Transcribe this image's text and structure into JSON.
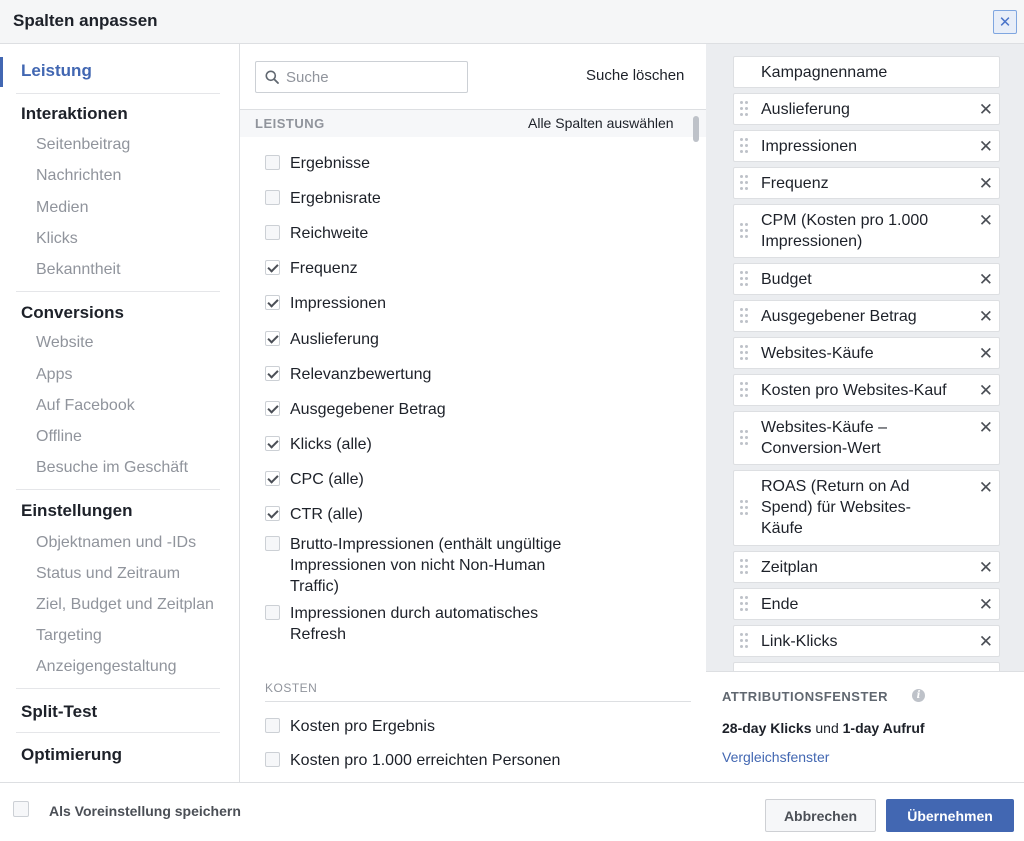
{
  "dialog": {
    "title": "Spalten anpassen",
    "close_icon": "close-icon",
    "close_glyph": "✕"
  },
  "sidebar": {
    "sections": [
      {
        "label": "Leistung",
        "active": true,
        "items": []
      },
      {
        "label": "Interaktionen",
        "items": [
          "Seitenbeitrag",
          "Nachrichten",
          "Medien",
          "Klicks",
          "Bekanntheit"
        ]
      },
      {
        "label": "Conversions",
        "items": [
          "Website",
          "Apps",
          "Auf Facebook",
          "Offline",
          "Besuche im Geschäft"
        ]
      },
      {
        "label": "Einstellungen",
        "items": [
          "Objektnamen und -IDs",
          "Status und Zeitraum",
          "Ziel, Budget und Zeitplan",
          "Targeting",
          "Anzeigengestaltung"
        ]
      },
      {
        "label": "Split-Test",
        "items": []
      },
      {
        "label": "Optimierung",
        "items": []
      }
    ]
  },
  "search": {
    "placeholder": "Suche",
    "value": "",
    "clear_label": "Suche löschen"
  },
  "metrics": {
    "section_label": "LEISTUNG",
    "select_all_label": "Alle Spalten auswählen",
    "options": [
      {
        "label": "Ergebnisse",
        "checked": false
      },
      {
        "label": "Ergebnisrate",
        "checked": false
      },
      {
        "label": "Reichweite",
        "checked": false
      },
      {
        "label": "Frequenz",
        "checked": true
      },
      {
        "label": "Impressionen",
        "checked": true
      },
      {
        "label": "Auslieferung",
        "checked": true
      },
      {
        "label": "Relevanzbewertung",
        "checked": true
      },
      {
        "label": "Ausgegebener Betrag",
        "checked": true
      },
      {
        "label": "Klicks (alle)",
        "checked": true
      },
      {
        "label": "CPC (alle)",
        "checked": true
      },
      {
        "label": "CTR (alle)",
        "checked": true
      },
      {
        "label": "Brutto-Impressionen (enthält ungültige Impressionen von nicht Non-Human Traffic)",
        "checked": false
      },
      {
        "label": "Impressionen durch automatisches Refresh",
        "checked": false
      }
    ],
    "cost_section_label": "KOSTEN",
    "cost_options": [
      {
        "label": "Kosten pro Ergebnis",
        "checked": false
      },
      {
        "label": "Kosten pro 1.000 erreichten Personen",
        "checked": false
      }
    ]
  },
  "selected_columns": {
    "items": [
      {
        "label": "Kampagnenname",
        "fixed": true
      },
      {
        "label": "Auslieferung"
      },
      {
        "label": "Impressionen"
      },
      {
        "label": "Frequenz"
      },
      {
        "label": "CPM (Kosten pro 1.000 Impressionen)"
      },
      {
        "label": "Budget"
      },
      {
        "label": "Ausgegebener Betrag"
      },
      {
        "label": "Websites-Käufe"
      },
      {
        "label": "Kosten pro Websites-Kauf"
      },
      {
        "label": "Websites-Käufe – Conversion-Wert"
      },
      {
        "label": "ROAS (Return on Ad Spend) für Websites-Käufe"
      },
      {
        "label": "Zeitplan"
      },
      {
        "label": "Ende"
      },
      {
        "label": "Link-Klicks"
      }
    ],
    "remove_glyph": "✕"
  },
  "attribution": {
    "title": "ATTRIBUTIONSFENSTER",
    "info_icon": "info-icon",
    "text_part1": "28-day Klicks",
    "text_part2": " und ",
    "text_part3": "1-day Aufruf",
    "link_label": "Vergleichsfenster"
  },
  "footer": {
    "save_default_label": "Als Voreinstellung speichern",
    "save_default_checked": false,
    "cancel_label": "Abbrechen",
    "apply_label": "Übernehmen"
  },
  "colors": {
    "accent": "#4267b2",
    "muted_text": "#90949c",
    "panel_bg": "#ebedf0"
  }
}
